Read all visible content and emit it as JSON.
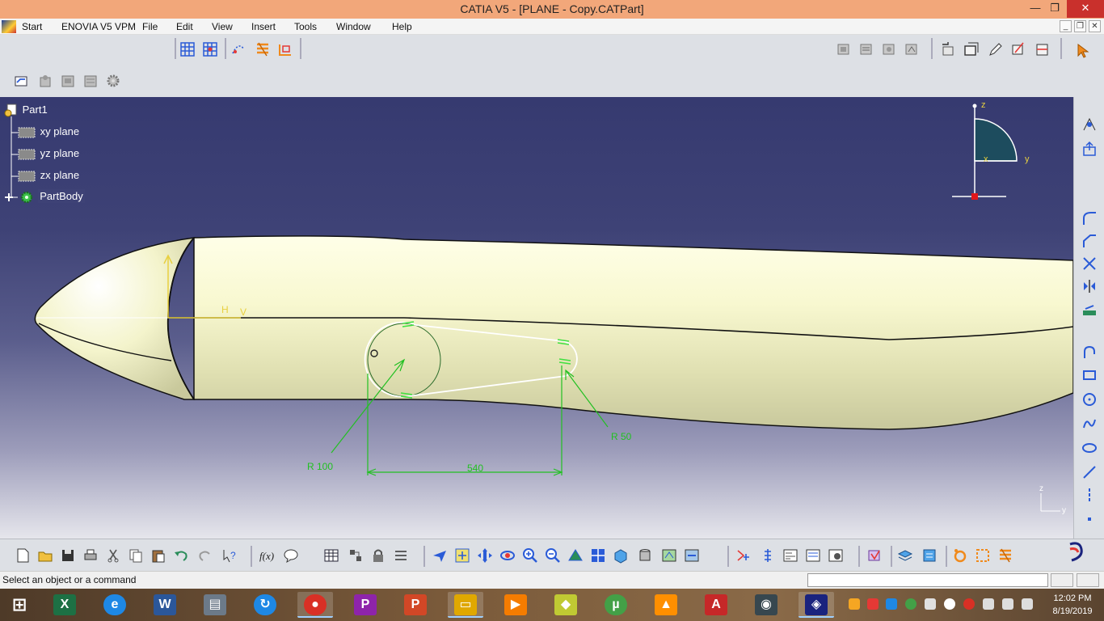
{
  "window": {
    "title": "CATIA V5 - [PLANE - Copy.CATPart]",
    "minimize_glyph": "—",
    "restore_glyph": "❐",
    "close_glyph": "✕"
  },
  "menu": {
    "items": [
      "Start",
      "ENOVIA V5 VPM",
      "File",
      "Edit",
      "View",
      "Insert",
      "Tools",
      "Window",
      "Help"
    ],
    "mdi_controls": [
      "_",
      "❐",
      "✕"
    ]
  },
  "tree": {
    "root": "Part1",
    "planes": [
      "xy plane",
      "yz plane",
      "zx plane"
    ],
    "body": "PartBody"
  },
  "sketch": {
    "h_label": "H",
    "v_label": "V",
    "dim_big_radius": "R 100",
    "dim_small_radius": "R 50",
    "dim_distance": "540"
  },
  "compass": {
    "z": "z",
    "y": "y",
    "x": "x"
  },
  "mini_axis": {
    "z": "z",
    "y": "y"
  },
  "status": {
    "message": "Select an object or a command",
    "command_value": ""
  },
  "clock": {
    "time": "12:02 PM",
    "date": "8/19/2019"
  },
  "taskbar": {
    "apps": [
      {
        "name": "start-button",
        "glyph": "⊞",
        "color": "#ffffff"
      },
      {
        "name": "excel-app",
        "glyph": "X",
        "color": "#1d7044"
      },
      {
        "name": "ie-app",
        "glyph": "e",
        "color": "#1e88e5"
      },
      {
        "name": "word-app",
        "glyph": "W",
        "color": "#2b579a"
      },
      {
        "name": "task-manager-app",
        "glyph": "▤",
        "color": "#6c7a89"
      },
      {
        "name": "sync-app",
        "glyph": "↻",
        "color": "#1e88e5"
      },
      {
        "name": "chrome-app",
        "glyph": "●",
        "color": "#d93025"
      },
      {
        "name": "picsart-app",
        "glyph": "P",
        "color": "#8e24aa"
      },
      {
        "name": "powerpoint-app",
        "glyph": "P",
        "color": "#d24726"
      },
      {
        "name": "file-explorer-app",
        "glyph": "▭",
        "color": "#e0a800"
      },
      {
        "name": "video-player-app",
        "glyph": "▶",
        "color": "#f57c00"
      },
      {
        "name": "notes-app",
        "glyph": "◆",
        "color": "#c0ca33"
      },
      {
        "name": "utorrent-app",
        "glyph": "µ",
        "color": "#43a047"
      },
      {
        "name": "vlc-app",
        "glyph": "▲",
        "color": "#ff8f00"
      },
      {
        "name": "acrobat-app",
        "glyph": "A",
        "color": "#c62828"
      },
      {
        "name": "media-app",
        "glyph": "◉",
        "color": "#37474f"
      },
      {
        "name": "catia-app",
        "glyph": "◈",
        "color": "#1a237e"
      }
    ]
  },
  "colors": {
    "sketch_green": "#22c022",
    "constraint_green": "#40e040",
    "compass_yellow": "#e8d040",
    "surface": "#f7f7cf",
    "selected_white": "#ffffff"
  }
}
